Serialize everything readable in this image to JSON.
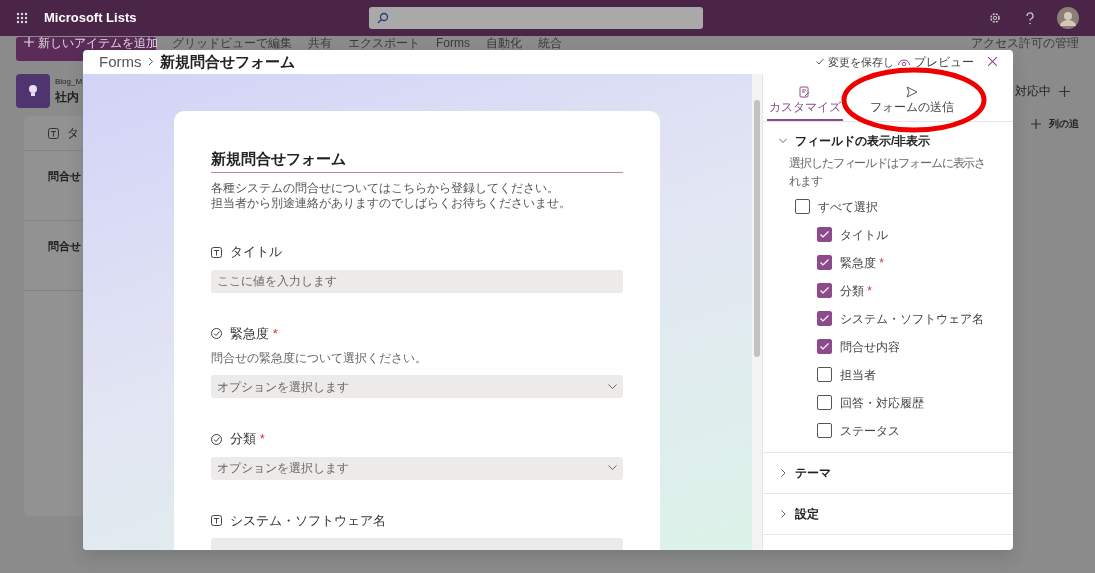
{
  "app_bar": {
    "app_name": "Microsoft Lists"
  },
  "toolbar": {
    "new_item": "新しいアイテムを追加",
    "items": [
      "グリッドビューで編集",
      "共有",
      "エクスポート",
      "Forms",
      "自動化",
      "統合"
    ],
    "permissions": "アクセス許可の管理"
  },
  "list": {
    "site": "Blog_M",
    "title": "社内",
    "column": "タ",
    "rows": [
      "問合せ",
      "問合せ"
    ],
    "view": "対応中",
    "add_column": "列の追"
  },
  "dialog": {
    "breadcrumb": [
      "Forms",
      "新規問合せフォーム"
    ],
    "save": "変更を保存し",
    "preview": "プレビュー",
    "form": {
      "title": "新規問合せフォーム",
      "description": [
        "各種システムの問合せについてはこちらから登録してください。",
        "担当者から別途連絡がありますのでしばらくお待ちくださいませ。"
      ],
      "fields": [
        {
          "kind": "text",
          "label": "タイトル",
          "placeholder": "ここに値を入力します"
        },
        {
          "kind": "choice",
          "label": "緊急度",
          "required_mark": "*",
          "help": "問合せの緊急度について選択ください。",
          "placeholder": "オプションを選択します"
        },
        {
          "kind": "choice",
          "label": "分類",
          "required_mark": "*",
          "placeholder": "オプションを選択します"
        },
        {
          "kind": "text",
          "label": "システム・ソフトウェア名"
        }
      ]
    },
    "panel": {
      "tabs": [
        {
          "kind": "customize",
          "label": "カスタマイズ",
          "selected": true
        },
        {
          "kind": "send",
          "label": "フォームの送信",
          "selected": false
        }
      ],
      "sections": [
        {
          "title": "フィールドの表示/非表示",
          "expanded": true,
          "hint": "選択したフィールドはフォームに表示されます",
          "select_all": {
            "label": "すべて選択",
            "checked": false
          },
          "fields": [
            {
              "label": "タイトル",
              "checked": true
            },
            {
              "label": "緊急度",
              "checked": true,
              "required_mark": "*"
            },
            {
              "label": "分類",
              "checked": true,
              "required_mark": "*"
            },
            {
              "label": "システム・ソフトウェア名",
              "checked": true
            },
            {
              "label": "問合せ内容",
              "checked": true
            },
            {
              "label": "担当者",
              "checked": false
            },
            {
              "label": "回答・対応履歴",
              "checked": false
            },
            {
              "label": "ステータス",
              "checked": false
            }
          ]
        },
        {
          "title": "テーマ",
          "expanded": false
        },
        {
          "title": "設定",
          "expanded": false
        }
      ]
    }
  },
  "annotation": {
    "kind": "ellipse"
  }
}
